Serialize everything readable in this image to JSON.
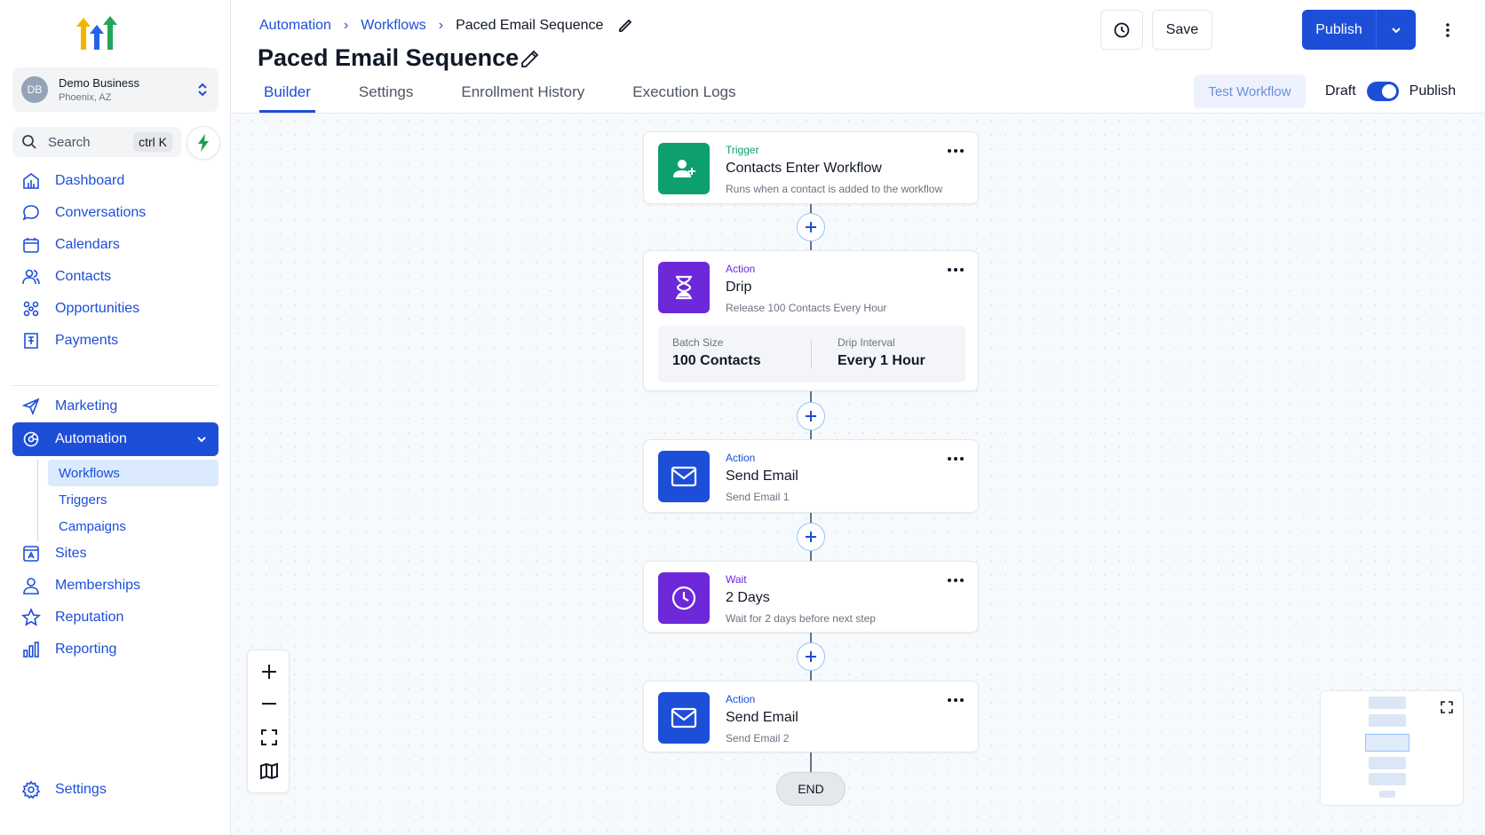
{
  "sidebar": {
    "account": {
      "initials": "DB",
      "name": "Demo Business",
      "location": "Phoenix, AZ"
    },
    "search": {
      "label": "Search",
      "shortcut": "ctrl K"
    },
    "nav_main": [
      {
        "label": "Dashboard",
        "icon": "dashboard-icon"
      },
      {
        "label": "Conversations",
        "icon": "chat-bubble-icon"
      },
      {
        "label": "Calendars",
        "icon": "calendar-icon"
      },
      {
        "label": "Contacts",
        "icon": "users-icon"
      },
      {
        "label": "Opportunities",
        "icon": "opportunities-icon"
      },
      {
        "label": "Payments",
        "icon": "receipt-icon"
      }
    ],
    "nav_marketing": {
      "label": "Marketing",
      "icon": "send-icon"
    },
    "nav_automation": {
      "label": "Automation",
      "icon": "automation-icon"
    },
    "automation_sub": [
      "Workflows",
      "Triggers",
      "Campaigns"
    ],
    "nav_more": [
      {
        "label": "Sites",
        "icon": "site-icon"
      },
      {
        "label": "Memberships",
        "icon": "user-icon"
      },
      {
        "label": "Reputation",
        "icon": "star-icon"
      },
      {
        "label": "Reporting",
        "icon": "bar-chart-icon"
      }
    ],
    "settings": {
      "label": "Settings",
      "icon": "gear-icon"
    }
  },
  "header": {
    "breadcrumb": [
      "Automation",
      "Workflows",
      "Paced Email Sequence"
    ],
    "title": "Paced Email Sequence",
    "tabs": [
      "Builder",
      "Settings",
      "Enrollment History",
      "Execution Logs"
    ],
    "active_tab": "Builder",
    "save_label": "Save",
    "publish_label": "Publish",
    "test_label": "Test Workflow",
    "toggle": {
      "left": "Draft",
      "right": "Publish",
      "on": true
    }
  },
  "workflow": {
    "trigger": {
      "type": "Trigger",
      "title": "Contacts Enter Workflow",
      "subtitle": "Runs when a contact is added to the workflow",
      "color": "#0e9f6e"
    },
    "drip": {
      "type": "Action",
      "title": "Drip",
      "subtitle": "Release 100 Contacts Every Hour",
      "color": "#6d28d9",
      "batch_label": "Batch Size",
      "batch_value": "100 Contacts",
      "interval_label": "Drip Interval",
      "interval_value": "Every 1 Hour"
    },
    "email1": {
      "type": "Action",
      "title": "Send Email",
      "subtitle": "Send Email 1",
      "color": "#1d4ed8"
    },
    "wait": {
      "type": "Wait",
      "title": "2 Days",
      "subtitle": "Wait for 2 days before next step",
      "color": "#6d28d9"
    },
    "email2": {
      "type": "Action",
      "title": "Send Email",
      "subtitle": "Send Email 2",
      "color": "#1d4ed8"
    },
    "end_label": "END"
  },
  "colors": {
    "accent": "#1d4ed8",
    "trigger_green": "#0e9f6e",
    "purple": "#6d28d9"
  }
}
